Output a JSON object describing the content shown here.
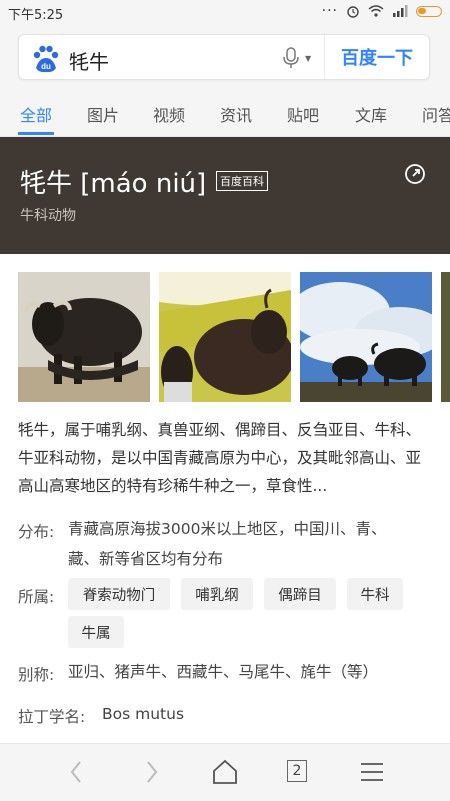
{
  "status_bar": {
    "time": "下午5:25",
    "battery_icon": "battery-icon",
    "wifi_icon": "wifi-icon",
    "signal_icon": "signal-icon",
    "alarm_icon": "alarm-icon"
  },
  "search": {
    "query": "牦牛",
    "button_label": "百度一下",
    "logo_text": "du"
  },
  "tabs": [
    {
      "label": "全部",
      "active": true
    },
    {
      "label": "图片"
    },
    {
      "label": "视频"
    },
    {
      "label": "资讯"
    },
    {
      "label": "贴吧"
    },
    {
      "label": "文库"
    },
    {
      "label": "问答"
    }
  ],
  "card": {
    "title": "牦牛 [máo niú]",
    "badge": "百度百科",
    "subtitle": "牛科动物"
  },
  "description": "牦牛，属于哺乳纲、真兽亚纲、偶蹄目、反刍亚目、牛科、牛亚科动物，是以中国青藏高原为中心，及其毗邻高山、亚高山高寒地区的特有珍稀牛种之一，草食性...",
  "distribution": {
    "label": "分布:",
    "line1": "青藏高原海拔3000米以上地区，中国川、青、",
    "line2": "藏、新等省区均有分布"
  },
  "taxonomy": {
    "label": "所属:",
    "chips": [
      "脊索动物门",
      "哺乳纲",
      "偶蹄目",
      "牛科",
      "牛属"
    ]
  },
  "alias": {
    "label": "别称:",
    "text": "亚归、猪声牛、西藏牛、马尾牛、旄牛（等）"
  },
  "latin": {
    "label": "拉丁学名:",
    "text": "Bos mutus"
  },
  "bottom_nav": {
    "tab_count": "2"
  }
}
